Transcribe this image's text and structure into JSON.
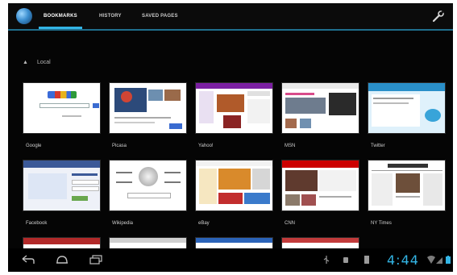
{
  "tabs": [
    {
      "label": "BOOKMARKS",
      "active": true
    },
    {
      "label": "HISTORY",
      "active": false
    },
    {
      "label": "SAVED PAGES",
      "active": false
    }
  ],
  "section": {
    "label": "Local"
  },
  "bookmarks": [
    {
      "label": "Google"
    },
    {
      "label": "Picasa"
    },
    {
      "label": "Yahoo!"
    },
    {
      "label": "MSN"
    },
    {
      "label": "Twitter"
    },
    {
      "label": "Facebook"
    },
    {
      "label": "Wikipedia"
    },
    {
      "label": "eBay"
    },
    {
      "label": "CNN"
    },
    {
      "label": "NY Times"
    }
  ],
  "status": {
    "time": "4:44"
  },
  "icons": {
    "app": "globe-icon",
    "settings": "wrench-icon",
    "back": "back-icon",
    "home": "home-icon",
    "recents": "recent-apps-icon"
  },
  "colors": {
    "accent": "#33b5e5",
    "background": "#050505"
  }
}
